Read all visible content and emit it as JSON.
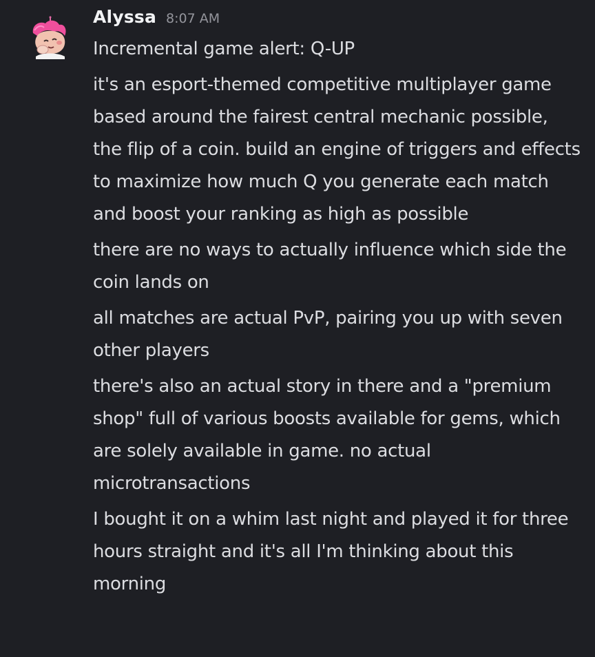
{
  "author": {
    "name": "Alyssa",
    "timestamp": "8:07 AM"
  },
  "messages": [
    "Incremental game alert: Q-UP",
    "it's an esport-themed competitive multiplayer game based around the fairest central mechanic possible, the flip of a coin. build an engine of triggers and effects to maximize how much Q you generate each match and boost your ranking as high as possible",
    "there are no ways to actually influence which side the coin lands on",
    "all matches are actual PvP, pairing you up with seven other players",
    "there's also an actual story in there and a \"premium shop\" full of various boosts available for gems, which are solely available in game. no actual microtransactions",
    "I bought it on a whim last night and played it for three hours straight and it's all I'm thinking about this morning"
  ],
  "colors": {
    "background": "#1e1f24",
    "username": "#f2f3f5",
    "timestamp": "#94959c",
    "text": "#dcdde1"
  }
}
